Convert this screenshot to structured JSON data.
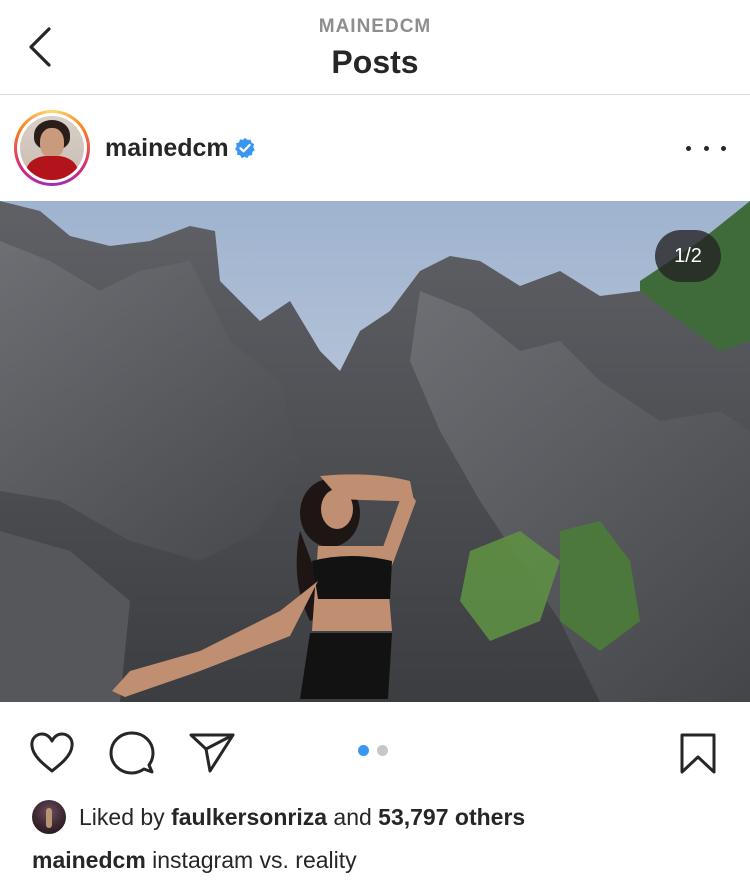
{
  "header": {
    "account": "MAINEDCM",
    "title": "Posts",
    "back_icon": "chevron-left-icon"
  },
  "post": {
    "username": "mainedcm",
    "verified_icon": "verified-badge-icon",
    "more_icon": "more-horizontal-icon",
    "image_counter": "1/2",
    "carousel": {
      "total": 2,
      "active_index": 0,
      "active_color": "#3897f0",
      "inactive_color": "#c7c7c7"
    }
  },
  "actions": {
    "like_icon": "heart-icon",
    "comment_icon": "comment-icon",
    "share_icon": "send-icon",
    "save_icon": "bookmark-icon"
  },
  "likes": {
    "prefix": "Liked by",
    "user": "faulkersonriza",
    "joiner": "and",
    "others": "53,797 others"
  },
  "caption": {
    "username": "mainedcm",
    "text": "instagram vs. reality"
  },
  "colors": {
    "text": "#262626",
    "muted": "#8e8e8e",
    "verified": "#3897f0",
    "divider": "#dbdbdb"
  }
}
